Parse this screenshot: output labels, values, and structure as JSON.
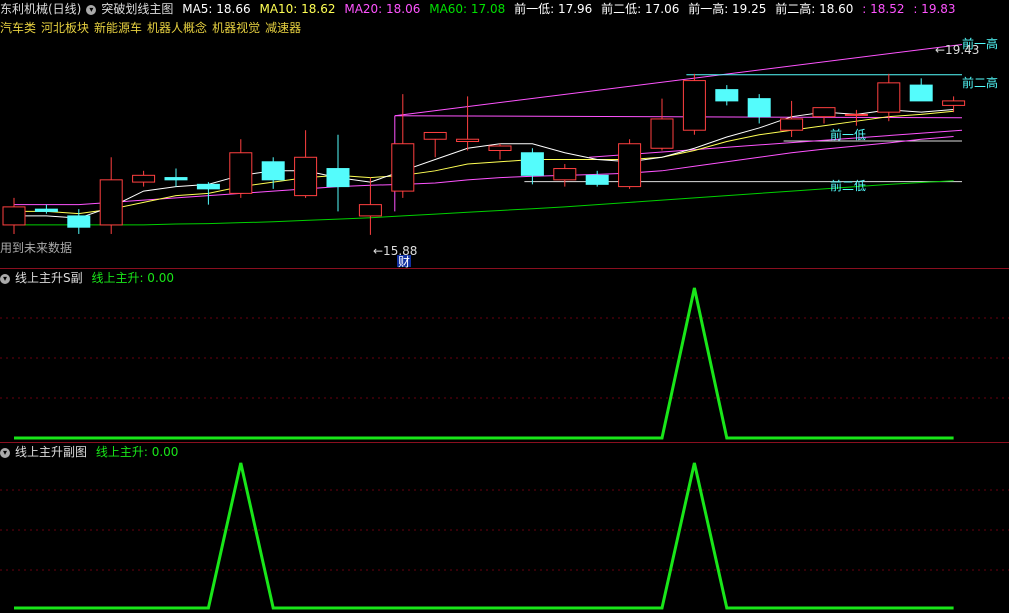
{
  "header": {
    "stock": "东利机械(日线)",
    "indicator": "突破划线主图",
    "ma5": "MA5: 18.66",
    "ma10": "MA10: 18.62",
    "ma20": "MA20: 18.06",
    "ma60": "MA60: 17.08",
    "prev_low1": "前一低: 17.96",
    "prev_low2": "前二低: 17.06",
    "prev_high1": "前一高: 19.25",
    "prev_high2": "前二高: 18.60",
    "extra1": ": 18.52",
    "extra2": ": 19.83"
  },
  "sectors": [
    "汽车类",
    "河北板块",
    "新能源车",
    "机器人概念",
    "机器视觉",
    "减速器"
  ],
  "notice": "用到未来数据",
  "marks": {
    "high_label": "19.43",
    "low_label": "15.88",
    "fin_badge": "财",
    "prev_high1": "前一高",
    "prev_high2": "前二高",
    "prev_low1": "前一低",
    "prev_low2": "前二低"
  },
  "panel2": {
    "title": "线上主升S副",
    "series": "线上主升: 0.00"
  },
  "panel3": {
    "title": "线上主升副图",
    "series": "线上主升: 0.00"
  },
  "colors": {
    "up": "#ff4040",
    "down": "#54fcfc",
    "ma5": "#ffffff",
    "ma10": "#ffff54",
    "ma20": "#ff54ff",
    "ma60": "#00d000",
    "signal": "#19e619"
  },
  "chart_data": [
    {
      "type": "candlestick",
      "ylim": [
        15.5,
        20.2
      ],
      "candles": [
        {
          "o": 16.1,
          "h": 16.7,
          "l": 15.9,
          "c": 16.5
        },
        {
          "o": 16.45,
          "h": 16.55,
          "l": 16.35,
          "c": 16.4
        },
        {
          "o": 16.3,
          "h": 16.45,
          "l": 15.9,
          "c": 16.05
        },
        {
          "o": 16.1,
          "h": 17.6,
          "l": 15.9,
          "c": 17.1
        },
        {
          "o": 17.05,
          "h": 17.3,
          "l": 16.95,
          "c": 17.2
        },
        {
          "o": 17.15,
          "h": 17.35,
          "l": 16.95,
          "c": 17.1
        },
        {
          "o": 17.0,
          "h": 17.05,
          "l": 16.55,
          "c": 16.9
        },
        {
          "o": 16.8,
          "h": 18.0,
          "l": 16.7,
          "c": 17.7
        },
        {
          "o": 17.5,
          "h": 17.6,
          "l": 16.9,
          "c": 17.1
        },
        {
          "o": 16.75,
          "h": 18.2,
          "l": 16.7,
          "c": 17.6
        },
        {
          "o": 17.35,
          "h": 18.1,
          "l": 16.4,
          "c": 16.95
        },
        {
          "o": 16.3,
          "h": 17.15,
          "l": 15.88,
          "c": 16.55
        },
        {
          "o": 16.85,
          "h": 19.0,
          "l": 16.7,
          "c": 17.9
        },
        {
          "o": 18.0,
          "h": 18.15,
          "l": 17.6,
          "c": 18.15
        },
        {
          "o": 17.95,
          "h": 18.95,
          "l": 17.75,
          "c": 18.0
        },
        {
          "o": 17.75,
          "h": 17.9,
          "l": 17.55,
          "c": 17.85
        },
        {
          "o": 17.7,
          "h": 17.8,
          "l": 17.0,
          "c": 17.2
        },
        {
          "o": 17.1,
          "h": 17.45,
          "l": 16.95,
          "c": 17.35
        },
        {
          "o": 17.2,
          "h": 17.3,
          "l": 16.95,
          "c": 17.0
        },
        {
          "o": 16.95,
          "h": 18.0,
          "l": 16.9,
          "c": 17.9
        },
        {
          "o": 17.8,
          "h": 18.9,
          "l": 17.75,
          "c": 18.45
        },
        {
          "o": 18.2,
          "h": 19.45,
          "l": 18.1,
          "c": 19.3
        },
        {
          "o": 19.1,
          "h": 19.2,
          "l": 18.75,
          "c": 18.85
        },
        {
          "o": 18.9,
          "h": 19.0,
          "l": 18.35,
          "c": 18.5
        },
        {
          "o": 18.2,
          "h": 18.85,
          "l": 18.05,
          "c": 18.45
        },
        {
          "o": 18.5,
          "h": 18.7,
          "l": 18.35,
          "c": 18.7
        },
        {
          "o": 18.55,
          "h": 18.65,
          "l": 18.3,
          "c": 18.55
        },
        {
          "o": 18.6,
          "h": 19.45,
          "l": 18.4,
          "c": 19.25
        },
        {
          "o": 19.2,
          "h": 19.35,
          "l": 18.85,
          "c": 18.85
        },
        {
          "o": 18.75,
          "h": 18.95,
          "l": 18.6,
          "c": 18.85
        }
      ],
      "ma5": [
        16.3,
        16.3,
        16.25,
        16.5,
        16.85,
        16.95,
        17.0,
        17.2,
        17.3,
        17.3,
        17.15,
        17.05,
        17.3,
        17.55,
        17.8,
        17.9,
        17.9,
        17.7,
        17.55,
        17.5,
        17.6,
        17.8,
        18.05,
        18.25,
        18.5,
        18.6,
        18.55,
        18.65,
        18.6,
        18.66
      ],
      "ma10": [
        16.4,
        16.4,
        16.35,
        16.45,
        16.6,
        16.75,
        16.8,
        16.95,
        17.05,
        17.15,
        17.2,
        17.15,
        17.2,
        17.3,
        17.45,
        17.5,
        17.55,
        17.55,
        17.55,
        17.55,
        17.6,
        17.75,
        17.95,
        18.1,
        18.2,
        18.3,
        18.4,
        18.5,
        18.55,
        18.62
      ],
      "ma20": [
        16.55,
        16.55,
        16.55,
        16.6,
        16.65,
        16.7,
        16.75,
        16.8,
        16.85,
        16.9,
        16.95,
        16.98,
        17.0,
        17.03,
        17.1,
        17.15,
        17.18,
        17.2,
        17.22,
        17.25,
        17.3,
        17.4,
        17.5,
        17.6,
        17.7,
        17.78,
        17.85,
        17.92,
        18.0,
        18.06
      ],
      "ma60": [
        16.1,
        16.1,
        16.1,
        16.1,
        16.1,
        16.12,
        16.13,
        16.15,
        16.17,
        16.2,
        16.23,
        16.26,
        16.3,
        16.34,
        16.38,
        16.42,
        16.46,
        16.5,
        16.55,
        16.6,
        16.65,
        16.7,
        16.75,
        16.8,
        16.85,
        16.9,
        16.95,
        17.0,
        17.04,
        17.08
      ],
      "levels": {
        "prev_high1": 19.83,
        "prev_high2": 18.52,
        "prev_low1": 18.52,
        "prev_low2": 17.06
      }
    },
    {
      "type": "line",
      "name": "线上主升S副",
      "series": [
        {
          "name": "线上主升",
          "values": [
            0,
            0,
            0,
            0,
            0,
            0,
            0,
            0,
            0,
            0,
            0,
            0,
            0,
            0,
            0,
            0,
            0,
            0,
            0,
            0,
            0,
            1,
            0,
            0,
            0,
            0,
            0,
            0,
            0,
            0
          ]
        }
      ],
      "ylim": [
        0,
        1
      ]
    },
    {
      "type": "line",
      "name": "线上主升副图",
      "series": [
        {
          "name": "线上主升",
          "values": [
            0,
            0,
            0,
            0,
            0,
            0,
            0,
            1,
            0,
            0,
            0,
            0,
            0,
            0,
            0,
            0,
            0,
            0,
            0,
            0,
            0,
            1,
            0,
            0,
            0,
            0,
            0,
            0,
            0,
            0
          ]
        }
      ],
      "ylim": [
        0,
        1
      ]
    }
  ]
}
